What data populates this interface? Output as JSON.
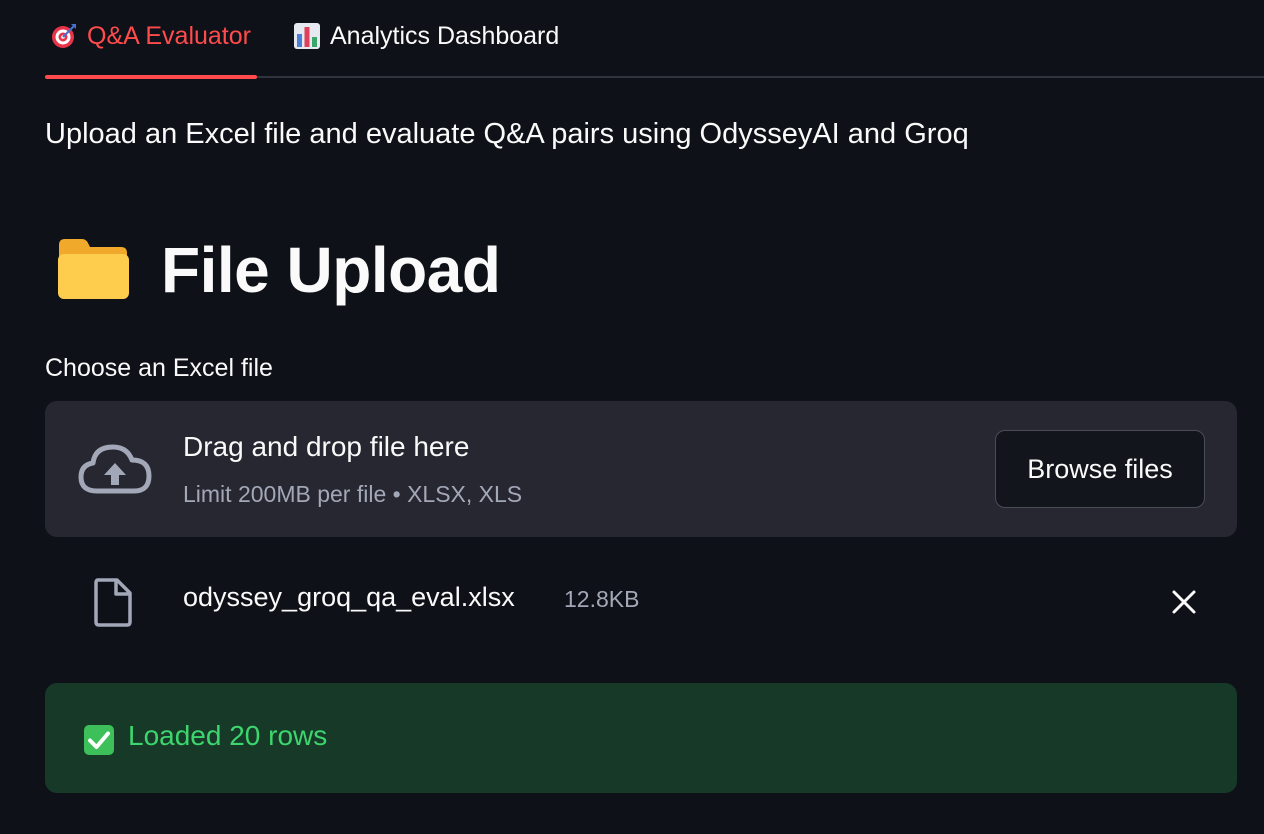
{
  "tabs": [
    {
      "label": "Q&A Evaluator",
      "icon": "target-icon",
      "active": true
    },
    {
      "label": "Analytics Dashboard",
      "icon": "bar-chart-icon",
      "active": false
    }
  ],
  "subtitle": "Upload an Excel file and evaluate Q&A pairs using OdysseyAI and Groq",
  "header": {
    "title": "File Upload",
    "icon": "folder-icon"
  },
  "uploader": {
    "label": "Choose an Excel file",
    "drop_title": "Drag and drop file here",
    "drop_hint": "Limit 200MB per file • XLSX, XLS",
    "browse_label": "Browse files"
  },
  "uploaded_file": {
    "name": "odyssey_groq_qa_eval.xlsx",
    "size": "12.8KB"
  },
  "status": {
    "message": "Loaded 20 rows",
    "icon": "check-icon"
  },
  "colors": {
    "background": "#0e1117",
    "accent": "#ff4b4b",
    "surface": "#262730",
    "success_bg": "#173928",
    "success_text": "#3dd56d"
  }
}
